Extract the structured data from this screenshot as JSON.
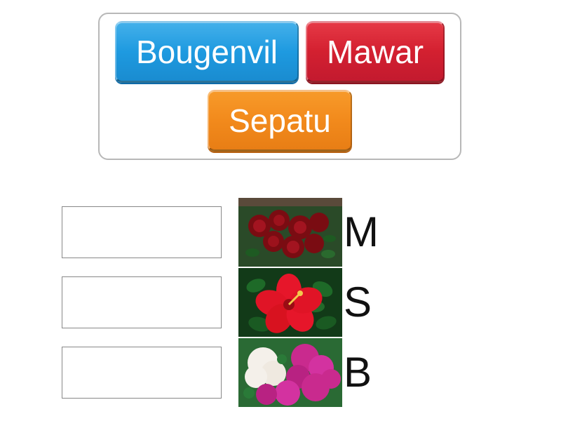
{
  "options": [
    {
      "label": "Bougenvil",
      "color": "blue"
    },
    {
      "label": "Mawar",
      "color": "red"
    },
    {
      "label": "Sepatu",
      "color": "orange"
    }
  ],
  "targets": [
    {
      "letter": "M",
      "image": "roses-red"
    },
    {
      "letter": "S",
      "image": "hibiscus-red"
    },
    {
      "letter": "B",
      "image": "bougainvillea-mixed"
    }
  ]
}
